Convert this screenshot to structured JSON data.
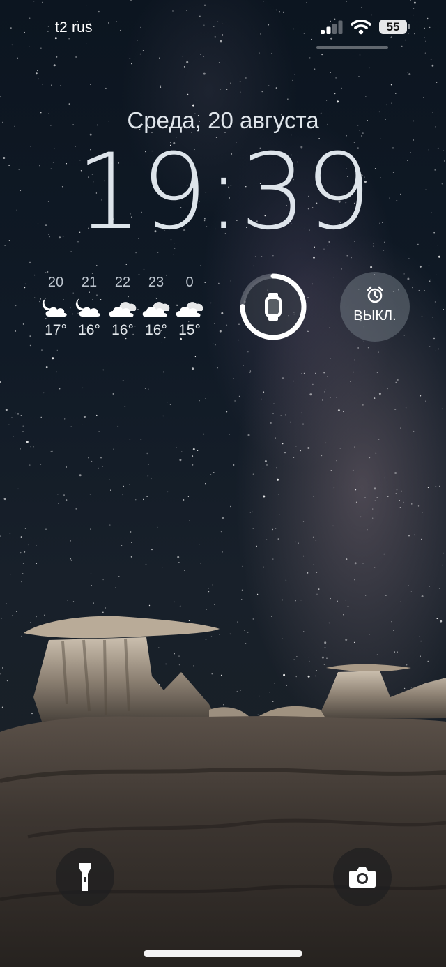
{
  "status_bar": {
    "carrier": "t2 rus",
    "battery_level": "55",
    "signal_bars_active": 2,
    "signal_bars_total": 4,
    "icons": [
      "cellular-signal-icon",
      "wifi-icon",
      "battery-icon"
    ]
  },
  "lock_screen": {
    "date": "Среда, 20 августа",
    "time": "19:39"
  },
  "weather_widget": {
    "hours": [
      {
        "hour": "20",
        "temp": "17°",
        "icon": "partly-cloudy-night-icon"
      },
      {
        "hour": "21",
        "temp": "16°",
        "icon": "partly-cloudy-night-icon"
      },
      {
        "hour": "22",
        "temp": "16°",
        "icon": "cloudy-icon"
      },
      {
        "hour": "23",
        "temp": "16°",
        "icon": "cloudy-icon"
      },
      {
        "hour": "0",
        "temp": "15°",
        "icon": "cloudy-icon"
      }
    ]
  },
  "watch_widget": {
    "icon": "apple-watch-icon",
    "battery_fraction": 0.75
  },
  "alarm_widget": {
    "icon": "alarm-clock-icon",
    "label": "ВЫКЛ."
  },
  "quick_actions": {
    "flashlight_icon": "flashlight-icon",
    "camera_icon": "camera-icon"
  },
  "colors": {
    "sky": "#101a26",
    "widget_bg": "#6e7680",
    "button_bg": "#1e1e20",
    "text": "#ffffff"
  }
}
